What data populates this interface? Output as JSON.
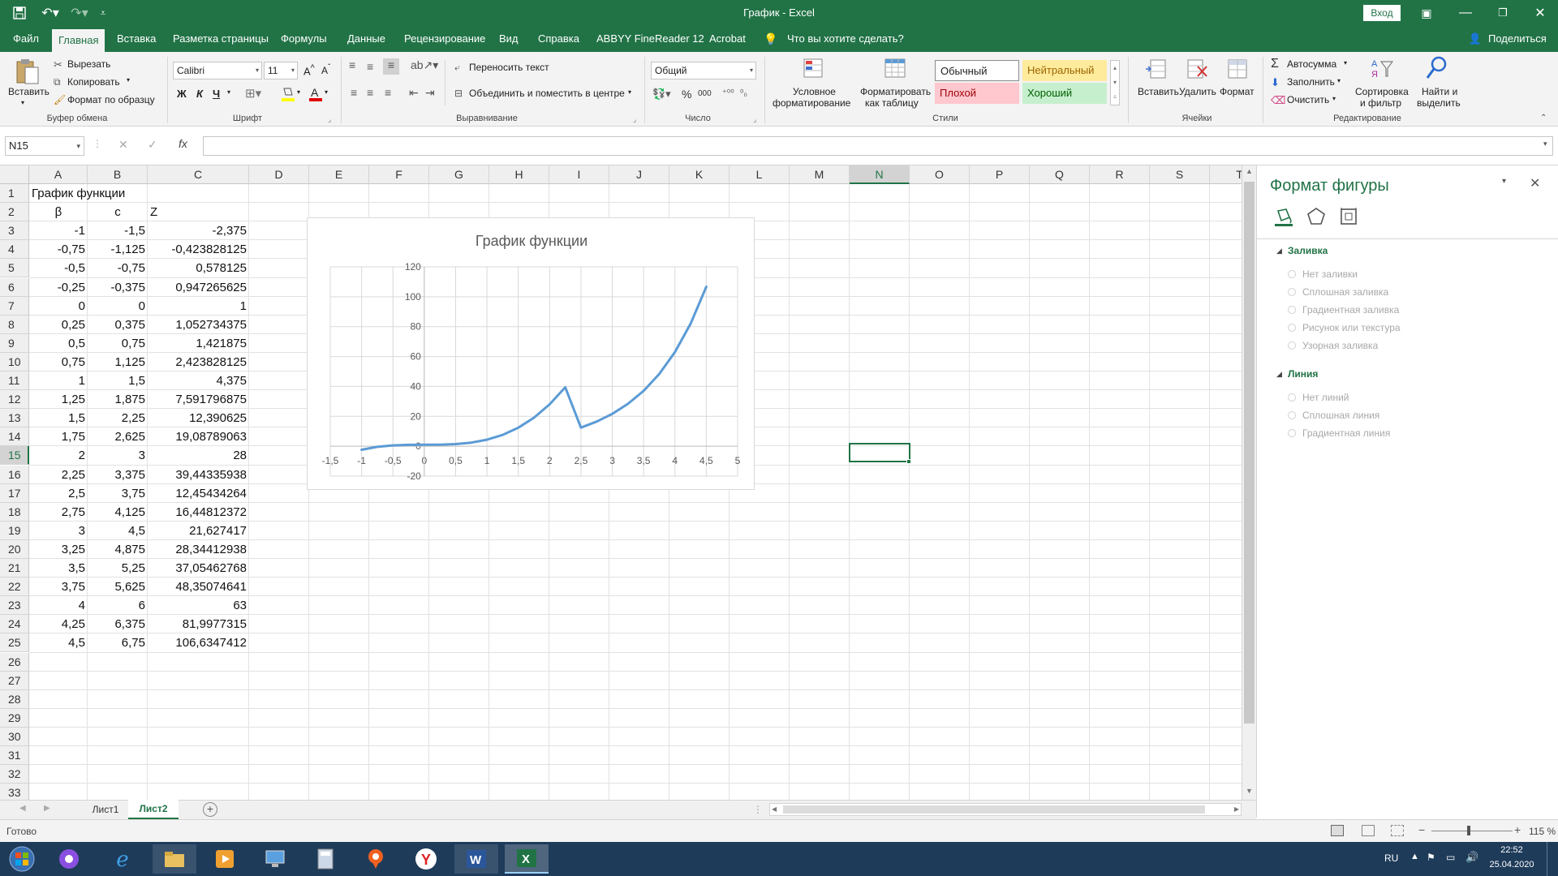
{
  "app": {
    "window_title": "График  -  Excel",
    "signin": "Вход"
  },
  "tabs": [
    "Файл",
    "Главная",
    "Вставка",
    "Разметка страницы",
    "Формулы",
    "Данные",
    "Рецензирование",
    "Вид",
    "Справка",
    "ABBYY FineReader 12",
    "Acrobat"
  ],
  "tell_me": "Что вы хотите сделать?",
  "share": "Поделиться",
  "ribbon": {
    "paste": "Вставить",
    "cut": "Вырезать",
    "copy": "Копировать",
    "format_painter": "Формат по образцу",
    "clipboard_group": "Буфер обмена",
    "font_name": "Calibri",
    "font_size": "11",
    "bold": "Ж",
    "italic": "К",
    "underline": "Ч",
    "font_group": "Шрифт",
    "wrap_text": "Переносить текст",
    "merge_center": "Объединить и поместить в центре",
    "alignment_group": "Выравнивание",
    "number_format": "Общий",
    "number_group": "Число",
    "conditional_1": "Условное",
    "conditional_2": "форматирование",
    "format_table_1": "Форматировать",
    "format_table_2": "как таблицу",
    "style_normal": "Обычный",
    "style_neutral": "Нейтральный",
    "style_bad": "Плохой",
    "style_good": "Хороший",
    "styles_group": "Стили",
    "insert": "Вставить",
    "delete": "Удалить",
    "format": "Формат",
    "cells_group": "Ячейки",
    "autosum": "Автосумма",
    "fill": "Заполнить",
    "clear": "Очистить",
    "sort_1": "Сортировка",
    "sort_2": "и фильтр",
    "find_1": "Найти и",
    "find_2": "выделить",
    "editing_group": "Редактирование"
  },
  "formula_bar": {
    "name_box": "N15",
    "formula": ""
  },
  "columns": [
    "A",
    "B",
    "C",
    "D",
    "E",
    "F",
    "G",
    "H",
    "I",
    "J",
    "K",
    "L",
    "M",
    "N",
    "O",
    "P",
    "Q",
    "R",
    "S",
    "T"
  ],
  "rows": [
    {
      "n": "1",
      "a": "График функции",
      "b": "",
      "c": ""
    },
    {
      "n": "2",
      "a": "β",
      "b": "c",
      "c": "Z"
    },
    {
      "n": "3",
      "a": "-1",
      "b": "-1,5",
      "c": "-2,375"
    },
    {
      "n": "4",
      "a": "-0,75",
      "b": "-1,125",
      "c": "-0,423828125"
    },
    {
      "n": "5",
      "a": "-0,5",
      "b": "-0,75",
      "c": "0,578125"
    },
    {
      "n": "6",
      "a": "-0,25",
      "b": "-0,375",
      "c": "0,947265625"
    },
    {
      "n": "7",
      "a": "0",
      "b": "0",
      "c": "1"
    },
    {
      "n": "8",
      "a": "0,25",
      "b": "0,375",
      "c": "1,052734375"
    },
    {
      "n": "9",
      "a": "0,5",
      "b": "0,75",
      "c": "1,421875"
    },
    {
      "n": "10",
      "a": "0,75",
      "b": "1,125",
      "c": "2,423828125"
    },
    {
      "n": "11",
      "a": "1",
      "b": "1,5",
      "c": "4,375"
    },
    {
      "n": "12",
      "a": "1,25",
      "b": "1,875",
      "c": "7,591796875"
    },
    {
      "n": "13",
      "a": "1,5",
      "b": "2,25",
      "c": "12,390625"
    },
    {
      "n": "14",
      "a": "1,75",
      "b": "2,625",
      "c": "19,08789063"
    },
    {
      "n": "15",
      "a": "2",
      "b": "3",
      "c": "28"
    },
    {
      "n": "16",
      "a": "2,25",
      "b": "3,375",
      "c": "39,44335938"
    },
    {
      "n": "17",
      "a": "2,5",
      "b": "3,75",
      "c": "12,45434264"
    },
    {
      "n": "18",
      "a": "2,75",
      "b": "4,125",
      "c": "16,44812372"
    },
    {
      "n": "19",
      "a": "3",
      "b": "4,5",
      "c": "21,627417"
    },
    {
      "n": "20",
      "a": "3,25",
      "b": "4,875",
      "c": "28,34412938"
    },
    {
      "n": "21",
      "a": "3,5",
      "b": "5,25",
      "c": "37,05462768"
    },
    {
      "n": "22",
      "a": "3,75",
      "b": "5,625",
      "c": "48,35074641"
    },
    {
      "n": "23",
      "a": "4",
      "b": "6",
      "c": "63"
    },
    {
      "n": "24",
      "a": "4,25",
      "b": "6,375",
      "c": "81,9977315"
    },
    {
      "n": "25",
      "a": "4,5",
      "b": "6,75",
      "c": "106,6347412"
    },
    {
      "n": "26",
      "a": "",
      "b": "",
      "c": ""
    },
    {
      "n": "27",
      "a": "",
      "b": "",
      "c": ""
    },
    {
      "n": "28",
      "a": "",
      "b": "",
      "c": ""
    },
    {
      "n": "29",
      "a": "",
      "b": "",
      "c": ""
    },
    {
      "n": "30",
      "a": "",
      "b": "",
      "c": ""
    },
    {
      "n": "31",
      "a": "",
      "b": "",
      "c": ""
    },
    {
      "n": "32",
      "a": "",
      "b": "",
      "c": ""
    },
    {
      "n": "33",
      "a": "",
      "b": "",
      "c": ""
    }
  ],
  "chart_data": {
    "type": "line",
    "title": "График функции",
    "x": [
      -1,
      -0.75,
      -0.5,
      -0.25,
      0,
      0.25,
      0.5,
      0.75,
      1,
      1.25,
      1.5,
      1.75,
      2,
      2.25,
      2.5,
      2.75,
      3,
      3.25,
      3.5,
      3.75,
      4,
      4.25,
      4.5
    ],
    "series": [
      {
        "values": [
          -2.375,
          -0.423828125,
          0.578125,
          0.947265625,
          1,
          1.052734375,
          1.421875,
          2.423828125,
          4.375,
          7.591796875,
          12.390625,
          19.08789063,
          28,
          39.44335938,
          12.45434264,
          16.44812372,
          21.627417,
          28.34412938,
          37.05462768,
          48.35074641,
          63,
          81.9977315,
          106.6347412
        ]
      }
    ],
    "xlim": [
      -1.5,
      5
    ],
    "ylim": [
      -20,
      120
    ],
    "x_ticks": [
      "-1,5",
      "-1",
      "-0,5",
      "0",
      "0,5",
      "1",
      "1,5",
      "2",
      "2,5",
      "3",
      "3,5",
      "4",
      "4,5",
      "5"
    ],
    "y_ticks": [
      "-20",
      "0",
      "20",
      "40",
      "60",
      "80",
      "100",
      "120"
    ],
    "grid": true,
    "line_color": "#5b9bd5"
  },
  "pane": {
    "title": "Формат фигуры",
    "fill_header": "Заливка",
    "fill_options": [
      "Нет заливки",
      "Сплошная заливка",
      "Градиентная заливка",
      "Рисунок или текстура",
      "Узорная заливка"
    ],
    "line_header": "Линия",
    "line_options": [
      "Нет линий",
      "Сплошная линия",
      "Градиентная линия"
    ]
  },
  "sheets": [
    "Лист1",
    "Лист2"
  ],
  "status": {
    "ready": "Готово",
    "zoom": "115 %"
  },
  "taskbar": {
    "lang": "RU",
    "time": "22:52",
    "date": "25.04.2020"
  },
  "colors": {
    "excel_green": "#217346",
    "selection": "#217346",
    "taskbar": "#1e3b5a"
  }
}
